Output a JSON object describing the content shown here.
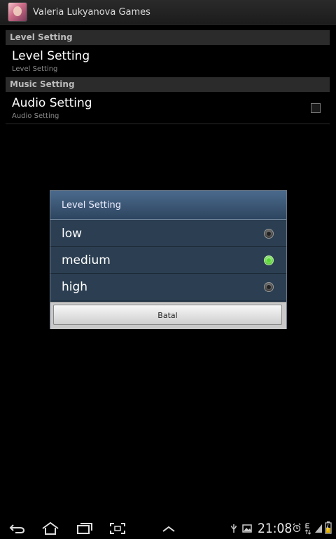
{
  "app": {
    "title": "Valeria Lukyanova Games"
  },
  "preferences": {
    "categories": [
      {
        "label": "Level Setting"
      },
      {
        "label": "Music Setting"
      }
    ],
    "items": [
      {
        "title": "Level Setting",
        "summary": "Level Setting"
      },
      {
        "title": "Audio Setting",
        "summary": "Audio Setting",
        "checked": false
      }
    ]
  },
  "dialog": {
    "title": "Level Setting",
    "options": [
      {
        "label": "low",
        "selected": false
      },
      {
        "label": "medium",
        "selected": true
      },
      {
        "label": "high",
        "selected": false
      }
    ],
    "cancel_label": "Batal"
  },
  "statusbar": {
    "time": "21:08"
  },
  "icons": {
    "nav": [
      "back-icon",
      "home-icon",
      "recent-apps-icon",
      "screenshot-icon",
      "up-chevron-icon"
    ],
    "status": [
      "usb-icon",
      "gallery-icon",
      "alarm-icon",
      "data-e-icon",
      "signal-icon",
      "battery-icon"
    ]
  },
  "colors": {
    "radio_selected": "#59d836",
    "dialog_header": "#3c5a7a"
  }
}
